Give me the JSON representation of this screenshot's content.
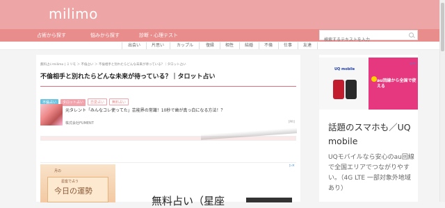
{
  "header": {
    "logo": "milimo"
  },
  "nav": {
    "items": [
      "占術から探す",
      "悩みから探す",
      "診断・心理テスト"
    ]
  },
  "search": {
    "placeholder": "検索するテキストを入力"
  },
  "subnav": {
    "items": [
      "出会い",
      "片思い",
      "カップル",
      "復縁",
      "相性",
      "結婚",
      "不倫",
      "仕事",
      "友達"
    ]
  },
  "article": {
    "breadcrumb": "無料占いmilimo | ミリモ  ＞  不倫占い  ＞  不倫相手と別れたらどんな未来が待っている？｜タロット占い",
    "title": "不倫相手と別れたらどんな未来が待っている？｜タロット占い",
    "tags": [
      {
        "label": "不倫占い",
        "bg": "#6cc3e0",
        "fg": "#fff"
      },
      {
        "label": "タロット占い",
        "bg": "#f2a2ab",
        "fg": "#fff"
      },
      {
        "label": "恋愛占い",
        "bg": "#fff",
        "fg": "#e98c8c"
      },
      {
        "label": "無料占い",
        "bg": "#fff",
        "fg": "#e98c8c"
      }
    ]
  },
  "ad": {
    "text": "元タレント「みんなコレ使ってた」芸能界の常識！10秒で歯が真っ白になる方法！？",
    "company": "株式会社FUMENT",
    "pr": "[PR]",
    "choice": "▷×"
  },
  "ad_bottom": {
    "tag": "月の",
    "small": "星座で占う",
    "big": "今日の運勢",
    "headline": "無料占い（星座"
  },
  "sidebar": {
    "ad_brand": "UQ mobile",
    "ad_promo": "au回線から全国で使える",
    "title": "話題のスマホも／UQ mobile",
    "body": "UQモバイルなら安心のau回線で全国エリアでつながりやすい。（4G LTE 一部対象外地域あり）",
    "choice": "▷×"
  },
  "colors": {
    "header": "#eea5a5",
    "nav": "#e98c8c",
    "accent": "#d96f7a"
  }
}
